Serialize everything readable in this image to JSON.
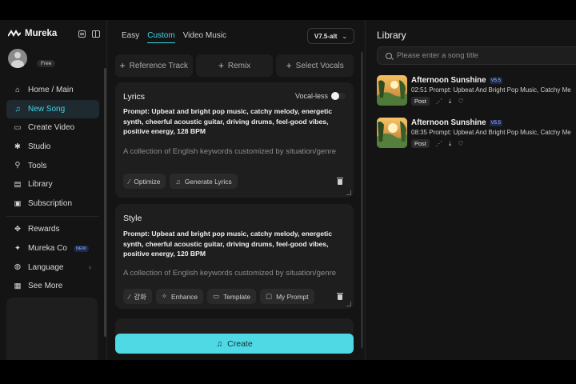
{
  "app": {
    "name": "Mureka"
  },
  "user": {
    "plan": "Free"
  },
  "sidebar": {
    "items": [
      {
        "label": "Home / Main",
        "icon": "home-icon",
        "glyph": "⌂"
      },
      {
        "label": "New Song",
        "icon": "music-note-icon",
        "glyph": "♫",
        "active": true
      },
      {
        "label": "Create Video",
        "icon": "video-icon",
        "glyph": "▭"
      },
      {
        "label": "Studio",
        "icon": "studio-icon",
        "glyph": "✱"
      },
      {
        "label": "Tools",
        "icon": "wrench-icon",
        "glyph": "⚲"
      },
      {
        "label": "Library",
        "icon": "library-icon",
        "glyph": "▤"
      },
      {
        "label": "Subscription",
        "icon": "subscription-icon",
        "glyph": "▣"
      }
    ],
    "items2": [
      {
        "label": "Rewards",
        "icon": "gift-icon",
        "glyph": "✥"
      },
      {
        "label": "Mureka Co",
        "icon": "community-icon",
        "glyph": "✦",
        "badge": "NEW"
      },
      {
        "label": "Language",
        "icon": "globe-icon",
        "glyph": "◍",
        "chevron": "›"
      },
      {
        "label": "See More",
        "icon": "grid-icon",
        "glyph": "▦"
      }
    ]
  },
  "center": {
    "tabs": [
      "Easy",
      "Custom",
      "Video Music"
    ],
    "active_tab": 1,
    "version": "V7.5-alt",
    "options": [
      "Reference Track",
      "Remix",
      "Select Vocals"
    ],
    "lyrics": {
      "title": "Lyrics",
      "vocal_less_label": "Vocal-less",
      "prompt": "Prompt: Upbeat and bright pop music, catchy melody, energetic synth, cheerful acoustic guitar, driving drums, feel-good vibes, positive energy, 128 BPM",
      "placeholder": "A collection of English keywords customized by situation/genre",
      "chips": [
        "Optimize",
        "Generate Lyrics"
      ]
    },
    "style": {
      "title": "Style",
      "prompt": "Prompt: Upbeat and bright pop music, catchy melody, energetic synth, cheerful acoustic guitar, driving drums, feel-good vibes, positive energy, 120 BPM",
      "placeholder": "A collection of English keywords customized by situation/genre",
      "chips": [
        "강화",
        "Enhance",
        "Template",
        "My Prompt"
      ]
    },
    "create_label": "Create"
  },
  "library": {
    "title": "Library",
    "search_placeholder": "Please enter a song title",
    "songs": [
      {
        "title": "Afternoon Sunshine",
        "version": "V5.5",
        "duration": "02:51",
        "prompt": "Prompt: Upbeat And Bright Pop Music, Catchy Me",
        "post_label": "Post"
      },
      {
        "title": "Afternoon Sunshine",
        "version": "V5.5",
        "duration": "08:35",
        "prompt": "Prompt: Upbeat And Bright Pop Music, Catchy Me",
        "post_label": "Post"
      }
    ]
  },
  "colors": {
    "accent": "#3fd6e6",
    "create_button": "#4fd9e4",
    "panel": "#1e1e1e",
    "background": "#141414"
  }
}
